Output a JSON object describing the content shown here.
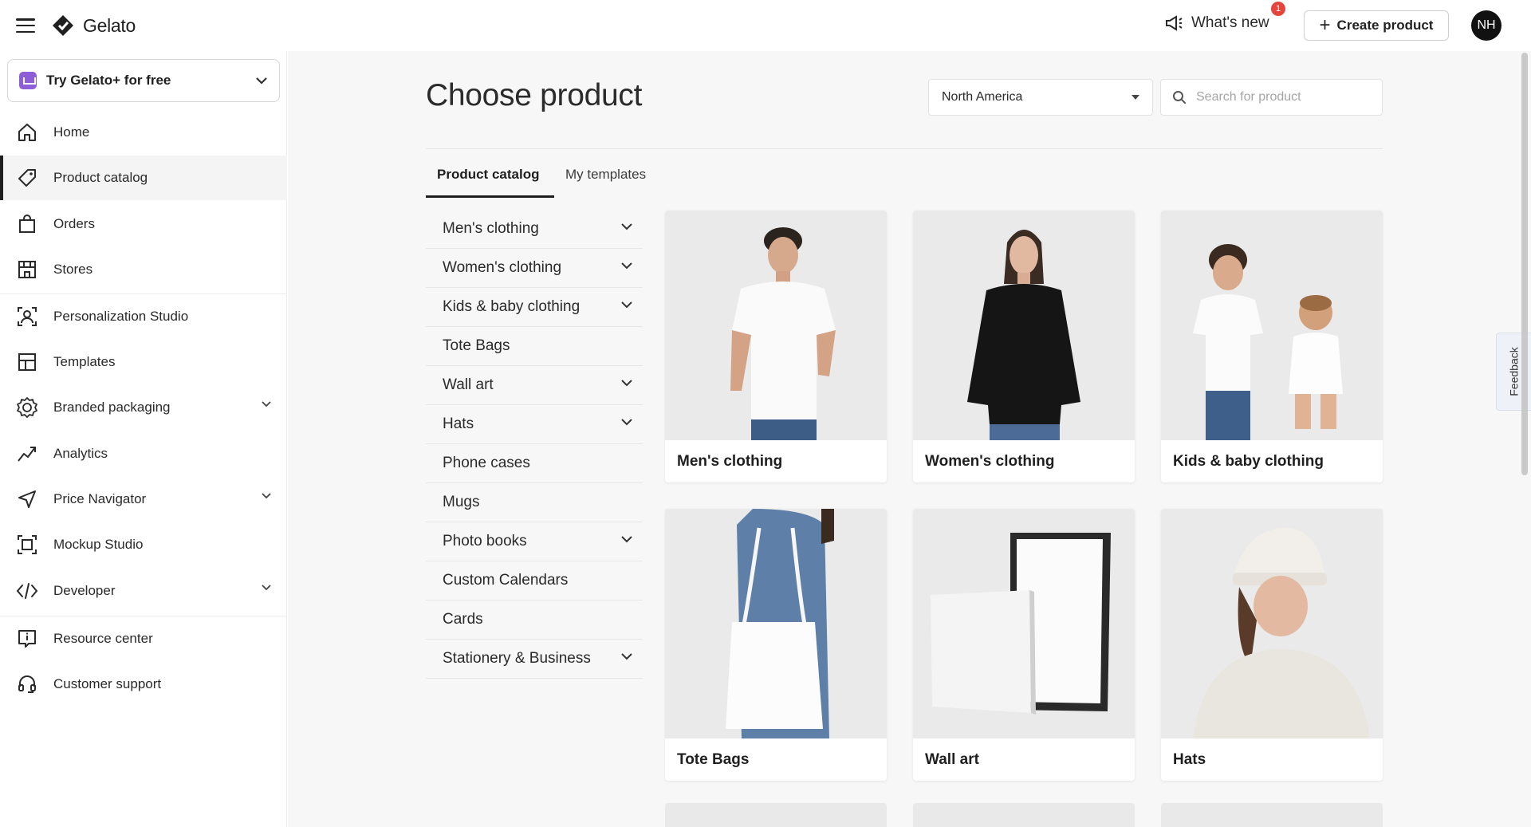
{
  "app": {
    "name": "Gelato"
  },
  "header": {
    "whats_new_label": "What's new",
    "notification_count": "1",
    "create_product_label": "Create product",
    "avatar_initials": "NH"
  },
  "sidebar": {
    "promo_label": "Try Gelato+ for free",
    "items": [
      {
        "label": "Home",
        "icon": "home-icon"
      },
      {
        "label": "Product catalog",
        "icon": "tag-icon",
        "active": true
      },
      {
        "label": "Orders",
        "icon": "shopping-bag-icon"
      },
      {
        "label": "Stores",
        "icon": "store-icon"
      },
      {
        "label": "Personalization Studio",
        "icon": "personalization-icon"
      },
      {
        "label": "Templates",
        "icon": "templates-icon"
      },
      {
        "label": "Branded packaging",
        "icon": "badge-icon",
        "expandable": true
      },
      {
        "label": "Analytics",
        "icon": "analytics-icon"
      },
      {
        "label": "Price Navigator",
        "icon": "navigation-icon",
        "expandable": true
      },
      {
        "label": "Mockup Studio",
        "icon": "mockup-icon"
      },
      {
        "label": "Developer",
        "icon": "code-icon",
        "expandable": true
      },
      {
        "label": "Resource center",
        "icon": "info-icon"
      },
      {
        "label": "Customer support",
        "icon": "headset-icon"
      }
    ]
  },
  "main": {
    "title": "Choose product",
    "region_selected": "North America",
    "search_placeholder": "Search for product",
    "tabs": [
      {
        "label": "Product catalog",
        "active": true
      },
      {
        "label": "My templates",
        "active": false
      }
    ],
    "categories": [
      {
        "label": "Men's clothing",
        "expandable": true
      },
      {
        "label": "Women's clothing",
        "expandable": true
      },
      {
        "label": "Kids & baby clothing",
        "expandable": true
      },
      {
        "label": "Tote Bags",
        "expandable": false
      },
      {
        "label": "Wall art",
        "expandable": true
      },
      {
        "label": "Hats",
        "expandable": true
      },
      {
        "label": "Phone cases",
        "expandable": false
      },
      {
        "label": "Mugs",
        "expandable": false
      },
      {
        "label": "Photo books",
        "expandable": true
      },
      {
        "label": "Custom Calendars",
        "expandable": false
      },
      {
        "label": "Cards",
        "expandable": false
      },
      {
        "label": "Stationery & Business",
        "expandable": true
      }
    ],
    "products": [
      {
        "label": "Men's clothing"
      },
      {
        "label": "Women's clothing"
      },
      {
        "label": "Kids & baby clothing"
      },
      {
        "label": "Tote Bags"
      },
      {
        "label": "Wall art"
      },
      {
        "label": "Hats"
      }
    ]
  },
  "feedback_label": "Feedback",
  "colors": {
    "accent": "#1f1f1f",
    "badge": "#e4463d",
    "promo_icon": "#8c5fd8",
    "main_bg": "#f7f7f7"
  }
}
